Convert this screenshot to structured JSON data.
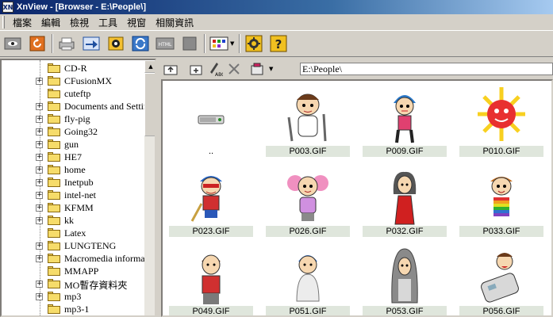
{
  "window": {
    "title": "XnView - [Browser - E:\\People\\]"
  },
  "menu": {
    "items": [
      "檔案",
      "編輯",
      "檢視",
      "工具",
      "視窗",
      "相關資訊"
    ]
  },
  "toolbar": {
    "buttons": [
      "eye-icon",
      "refresh-icon",
      "printer-icon",
      "convert-icon",
      "capture-icon",
      "batch-icon",
      "html-icon",
      "blank-icon",
      "slideshow-icon",
      "settings-icon",
      "help-icon"
    ]
  },
  "tree": {
    "items": [
      {
        "label": "CD-R",
        "expandable": false
      },
      {
        "label": "CFusionMX",
        "expandable": true
      },
      {
        "label": "cuteftp",
        "expandable": false
      },
      {
        "label": "Documents and Settin",
        "expandable": true
      },
      {
        "label": "fly-pig",
        "expandable": true
      },
      {
        "label": "Going32",
        "expandable": true
      },
      {
        "label": "gun",
        "expandable": true
      },
      {
        "label": "HE7",
        "expandable": true
      },
      {
        "label": "home",
        "expandable": true
      },
      {
        "label": "Inetpub",
        "expandable": true
      },
      {
        "label": "intel-net",
        "expandable": true
      },
      {
        "label": "KFMM",
        "expandable": true
      },
      {
        "label": "kk",
        "expandable": true
      },
      {
        "label": "Latex",
        "expandable": false
      },
      {
        "label": "LUNGTENG",
        "expandable": true
      },
      {
        "label": "Macromedia informat",
        "expandable": true
      },
      {
        "label": "MMAPP",
        "expandable": false
      },
      {
        "label": "MO暫存資料夾",
        "expandable": true
      },
      {
        "label": "mp3",
        "expandable": true
      },
      {
        "label": "mp3-1",
        "expandable": false
      }
    ]
  },
  "browser": {
    "path": "E:\\People\\",
    "tools": [
      "parent-folder-icon",
      "new-folder-icon",
      "rename-icon",
      "delete-icon",
      "filter-icon"
    ]
  },
  "thumbnails": [
    {
      "name": "..",
      "kind": "drive"
    },
    {
      "name": "P003.GIF",
      "kind": "chef"
    },
    {
      "name": "P009.GIF",
      "kind": "girl-blue"
    },
    {
      "name": "P010.GIF",
      "kind": "sun"
    },
    {
      "name": "P023.GIF",
      "kind": "boy-cap"
    },
    {
      "name": "P026.GIF",
      "kind": "girl-pink"
    },
    {
      "name": "P032.GIF",
      "kind": "woman-red"
    },
    {
      "name": "P033.GIF",
      "kind": "kid-rainbow"
    },
    {
      "name": "P049.GIF",
      "kind": "man-red"
    },
    {
      "name": "P051.GIF",
      "kind": "ghost-blue"
    },
    {
      "name": "P053.GIF",
      "kind": "hooded-grey"
    },
    {
      "name": "P056.GIF",
      "kind": "phone-man"
    }
  ],
  "colors": {
    "title_start": "#0a246a",
    "title_end": "#a6caf0",
    "caption_bg": "#dfe6dc",
    "folder": "#f6dc6a"
  }
}
